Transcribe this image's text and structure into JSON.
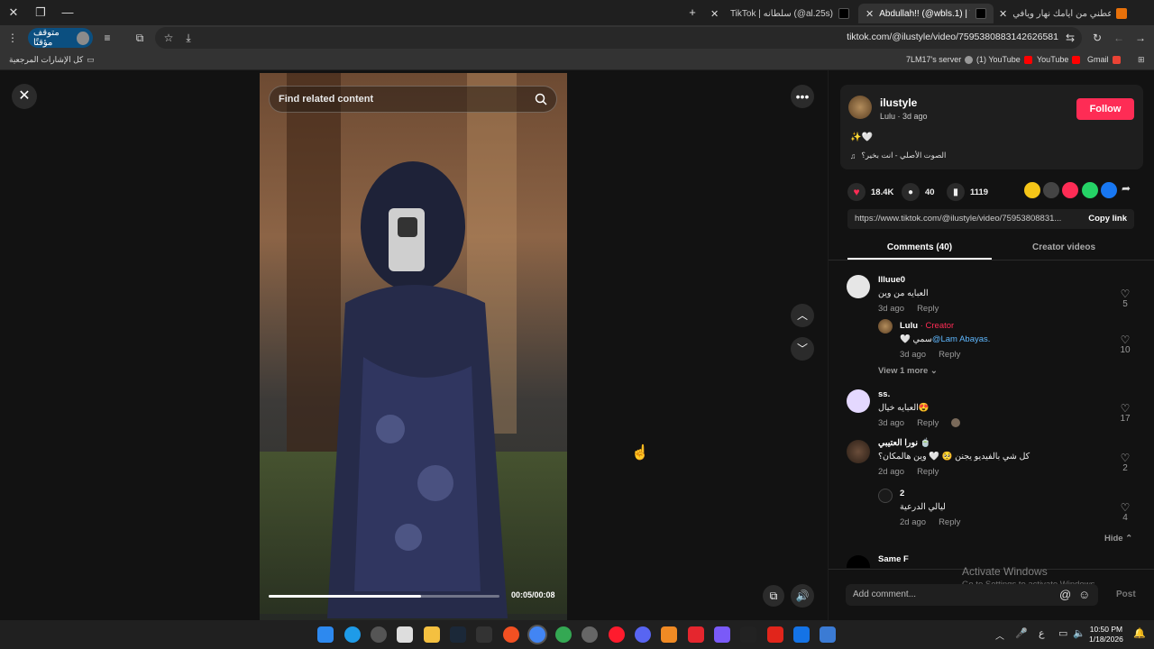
{
  "browser": {
    "tabs": [
      {
        "title": "عطني من أيامك نهار ويافي Cloud",
        "favicon_color": "#e8710a"
      },
      {
        "title": "Abdullah!! (@wbls.1) | TikTok",
        "favicon_color": "#000000"
      },
      {
        "title": "TikTok | سلطانه (@al.25s)",
        "favicon_color": "#000000"
      }
    ],
    "new_tab_symbol": "+",
    "profile_label": "متوقف مؤقتًا",
    "url": "tiktok.com/@ilustyle/video/7595380883142626581",
    "bookmarks": {
      "all_bookmarks": "كل الإشارات المرجعية",
      "items": [
        "7LM17's server",
        "(1) YouTube",
        "YouTube",
        "Gmail"
      ]
    }
  },
  "video": {
    "search_placeholder": "Find related content",
    "time": "00:05/00:08",
    "progress_fraction": 0.66
  },
  "author": {
    "username": "ilustyle",
    "subline": "Lulu · 3d ago",
    "follow_label": "Follow",
    "caption": "✨🤍",
    "sound": "الصوت الأصلي - انت بخير؟"
  },
  "stats": {
    "likes": "18.4K",
    "comments": "40",
    "saves": "1119"
  },
  "share_colors": [
    "#f5c518",
    "#444444",
    "#fe2c55",
    "#25d366",
    "#1877f2"
  ],
  "link": {
    "url": "https://www.tiktok.com/@ilustyle/video/75953808831...",
    "copy_label": "Copy link"
  },
  "tabs": {
    "comments": "Comments (40)",
    "creator": "Creator videos"
  },
  "comments": [
    {
      "user": "llluue0",
      "text": "العبايه من وين",
      "date": "3d ago",
      "reply": "Reply",
      "likes": "5"
    },
    {
      "user": "Lulu",
      "creator": "· Creator",
      "text": "🤍 سمي",
      "mention": "@Lam Abayas.",
      "date": "3d ago",
      "reply": "Reply",
      "likes": "10"
    },
    {
      "user": "ss.",
      "text": "العبايه خيال😍",
      "date": "3d ago",
      "reply": "Reply",
      "likes": "17"
    },
    {
      "user": "نورا العتيبي 🍵",
      "text": "كل شي بالفيديو يجنن 🥺 🤍 وين هالمكان؟",
      "date": "2d ago",
      "reply": "Reply",
      "likes": "2"
    },
    {
      "user": "2",
      "text": "ليالي الدرعية",
      "date": "2d ago",
      "reply": "Reply",
      "likes": "4"
    },
    {
      "user": "Same F"
    }
  ],
  "view_more": "View 1 more",
  "hide": "Hide",
  "add_comment_placeholder": "Add comment...",
  "post_label": "Post",
  "watermark": {
    "title": "Activate Windows",
    "sub": "Go to Settings to activate Windows."
  },
  "taskbar": {
    "time": "10:50 PM",
    "date": "1/18/2026",
    "lang": "ع"
  }
}
